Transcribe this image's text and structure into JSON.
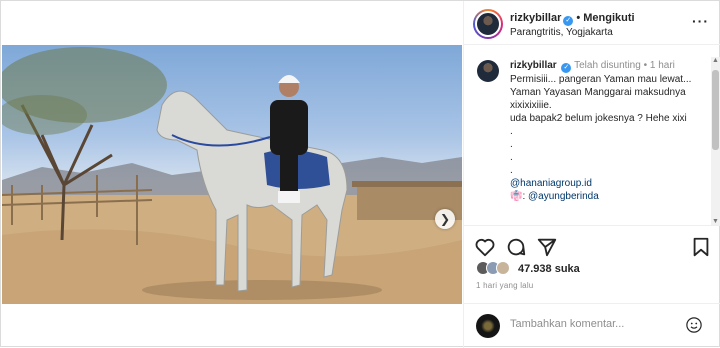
{
  "post": {
    "username": "rizkybillar",
    "verified_glyph": "✓",
    "separator": "•",
    "follow_label": "Mengikuti",
    "location": "Parangtritis, Yogjakarta",
    "more_icon": "more-icon",
    "more_glyph": "···"
  },
  "carousel": {
    "next_glyph": "❯",
    "slide_count": 2,
    "active_index": 0
  },
  "caption": {
    "username": "rizkybillar",
    "edited": "Telah disunting",
    "separator": "•",
    "time": "1 hari",
    "lines": [
      "Permisiii... pangeran Yaman mau lewat...",
      "Yaman Yayasan Manggarai maksudnya",
      "xixixixiiie.",
      "uda bapak2 belum jokesnya ? Hehe xixi",
      ".",
      ".",
      ".",
      "."
    ],
    "mention_1": "@hananiagroup.id",
    "mention_2_prefix": "👘:",
    "mention_2": "@ayungberinda"
  },
  "actions": {
    "likes": "47.938 suka",
    "time_ago": "1 hari yang lalu"
  },
  "comment": {
    "placeholder": "Tambahkan komentar..."
  },
  "colors": {
    "verified": "#3897f0",
    "link": "#00376b",
    "carousel_active": "#1a73e8",
    "muted": "#8e8e8e"
  },
  "icons": [
    "heart-icon",
    "comment-icon",
    "share-icon",
    "bookmark-icon",
    "emoji-icon",
    "chevron-right-icon",
    "more-icon"
  ]
}
